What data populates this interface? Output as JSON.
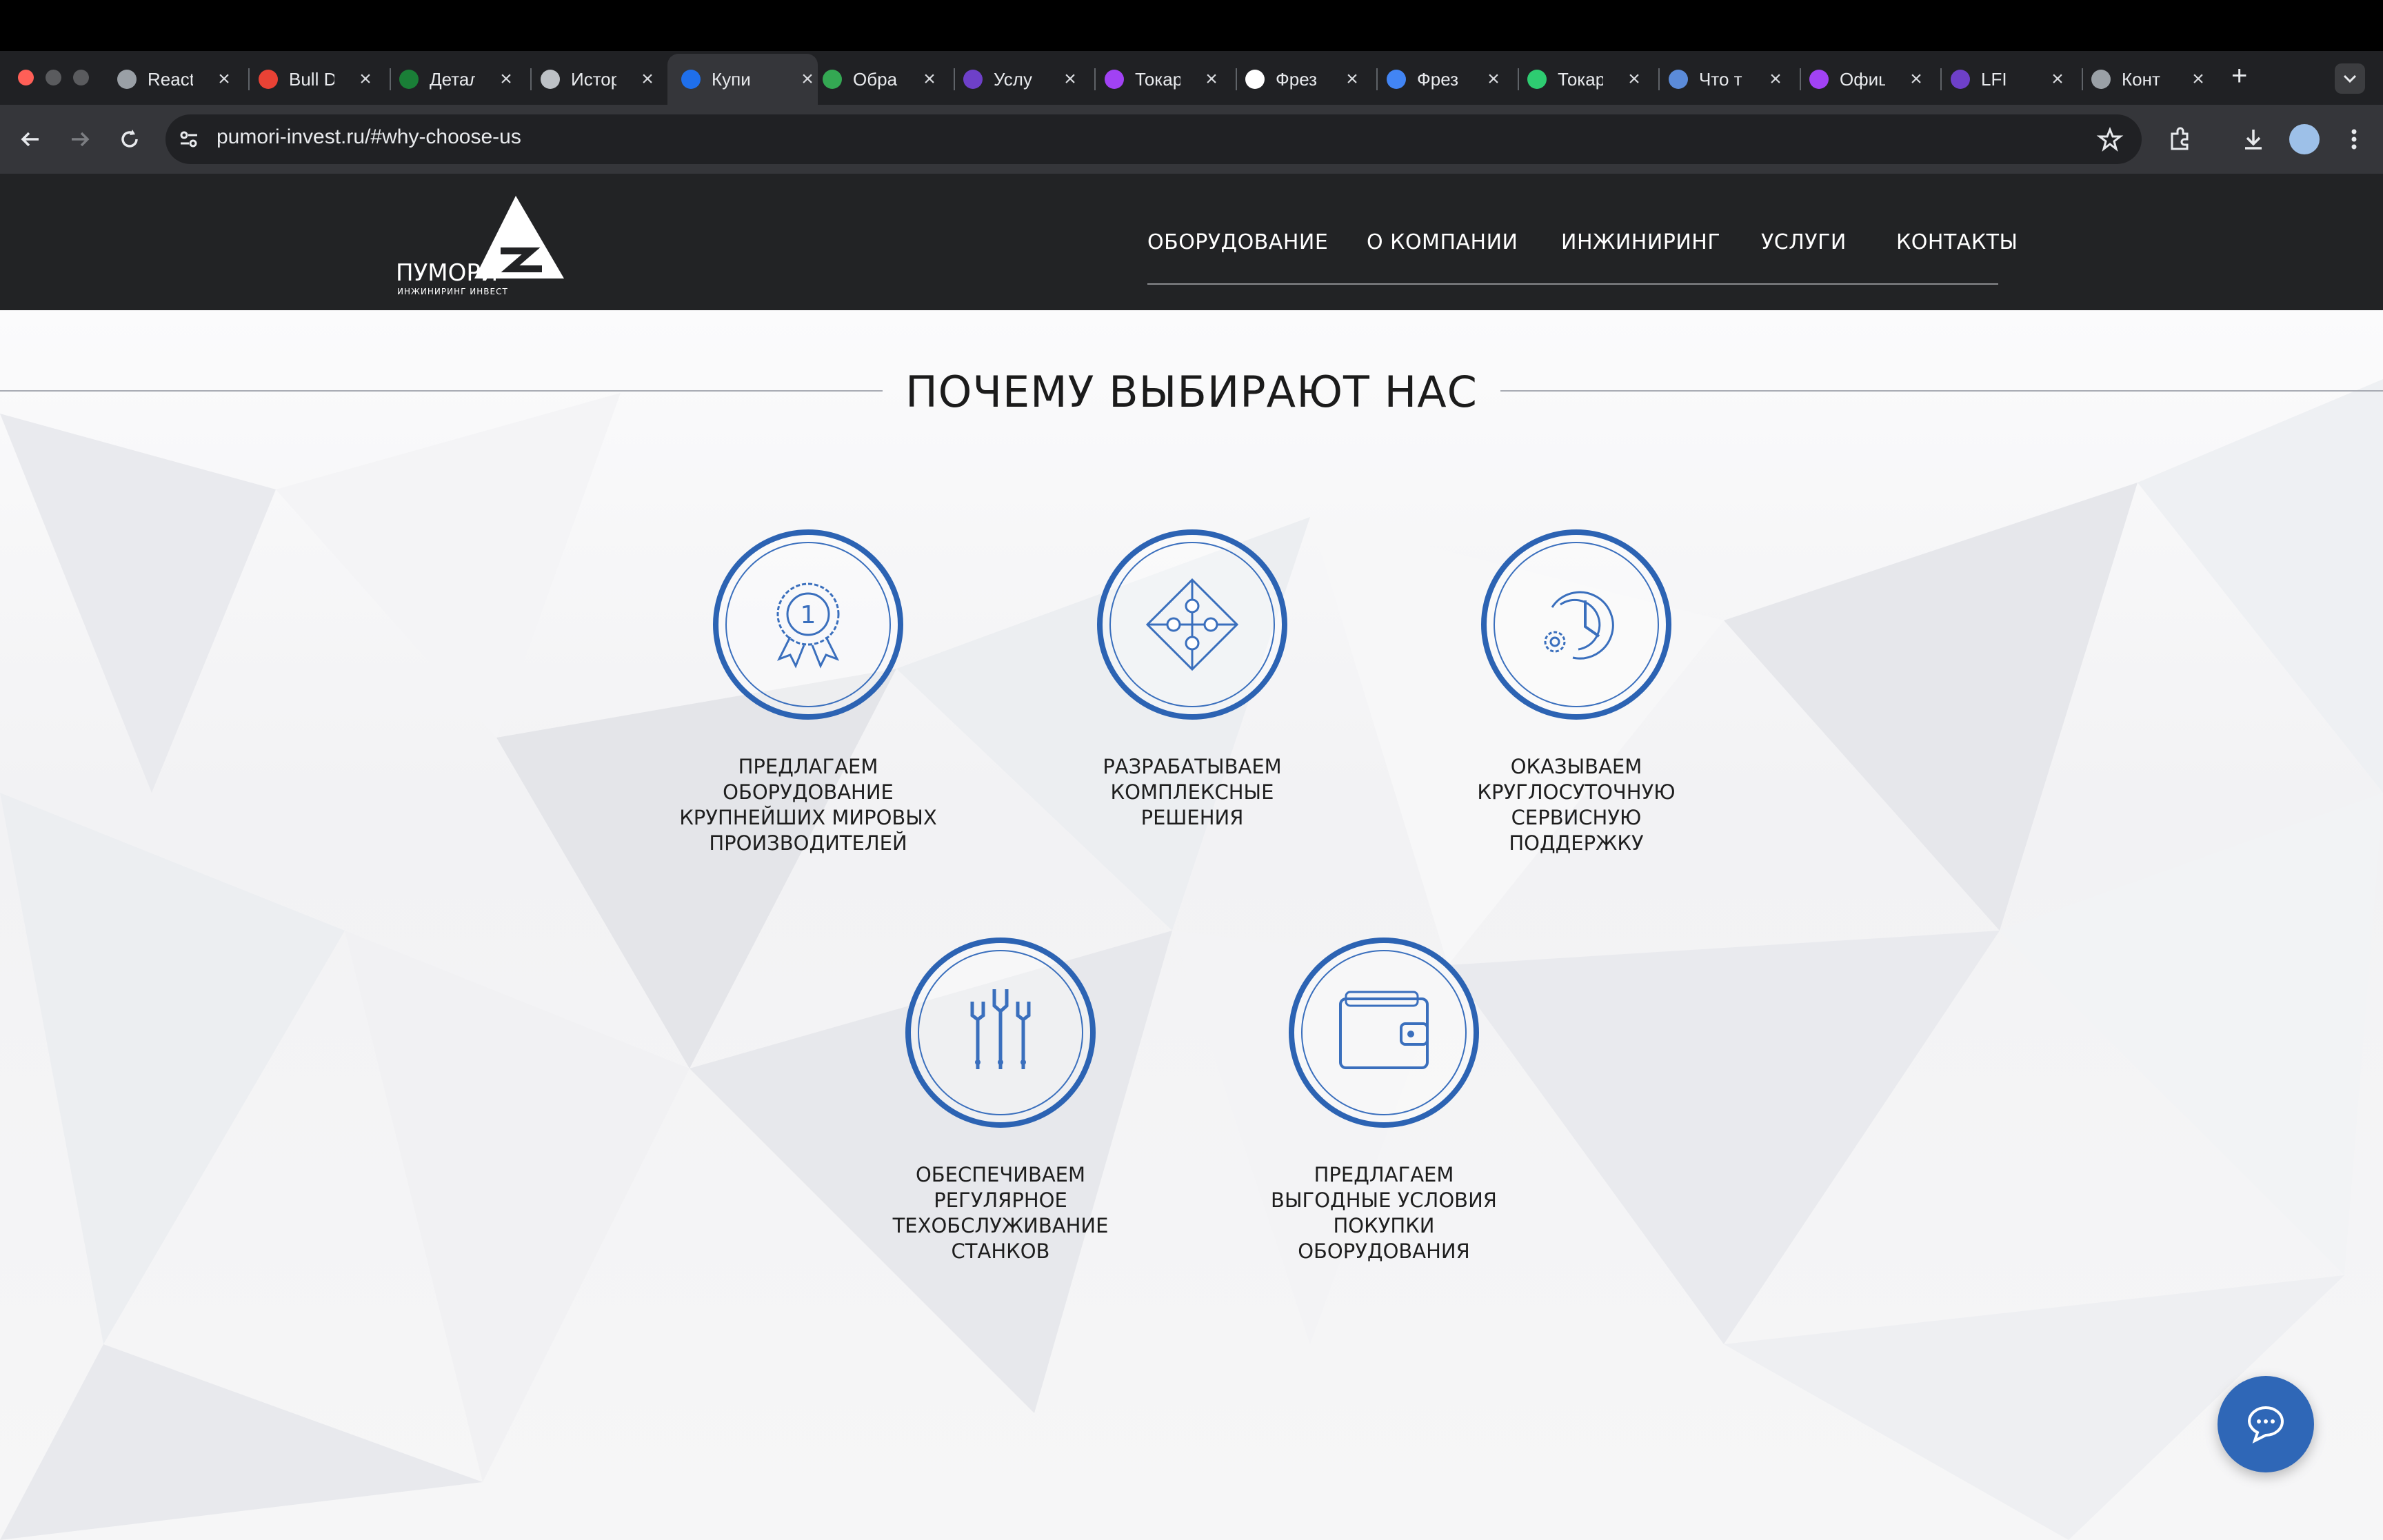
{
  "browser": {
    "tabs": [
      {
        "title": "React"
      },
      {
        "title": "Bull D"
      },
      {
        "title": "Детал"
      },
      {
        "title": "Истор"
      },
      {
        "title": "Купи"
      },
      {
        "title": "Обра"
      },
      {
        "title": "Услу"
      },
      {
        "title": "Токар"
      },
      {
        "title": "Фрез"
      },
      {
        "title": "Фрез"
      },
      {
        "title": "Токар"
      },
      {
        "title": "Что т"
      },
      {
        "title": "Офиц"
      },
      {
        "title": "LFI"
      },
      {
        "title": "Конт"
      }
    ],
    "new_tab": "+",
    "url": "pumori-invest.ru/#why-choose-us"
  },
  "site": {
    "logo": {
      "name": "ПУМОРИ",
      "tagline": "ИНЖИНИРИНГ ИНВЕСТ"
    },
    "nav": [
      {
        "label": "ОБОРУДОВАНИЕ"
      },
      {
        "label": "О КОМПАНИИ"
      },
      {
        "label": "ИНЖИНИРИНГ"
      },
      {
        "label": "УСЛУГИ"
      },
      {
        "label": "КОНТАКТЫ"
      }
    ],
    "section_title": "ПОЧЕМУ ВЫБИРАЮТ НАС",
    "features": [
      {
        "icon": "award-medal-icon",
        "text": "ПРЕДЛАГАЕМ\nОБОРУДОВАНИЕ\nКРУПНЕЙШИХ МИРОВЫХ\nПРОИЗВОДИТЕЛЕЙ"
      },
      {
        "icon": "puzzle-icon",
        "text": "РАЗРАБАТЫВАЕМ\nКОМПЛЕКСНЫЕ\nРЕШЕНИЯ"
      },
      {
        "icon": "clock-gear-icon",
        "text": "ОКАЗЫВАЕМ\nКРУГЛОСУТОЧНУЮ\nСЕРВИСНУЮ\nПОДДЕРЖКУ"
      },
      {
        "icon": "wrenches-icon",
        "text": "ОБЕСПЕЧИВАЕМ\nРЕГУЛЯРНОЕ\nТЕХОБСЛУЖИВАНИЕ\nСТАНКОВ"
      },
      {
        "icon": "wallet-icon",
        "text": "ПРЕДЛАГАЕМ\nВЫГОДНЫЕ УСЛОВИЯ\nПОКУПКИ\nОБОРУДОВАНИЯ"
      }
    ],
    "colors": {
      "accent": "#2c63b3",
      "nav_bg": "#222325"
    }
  }
}
